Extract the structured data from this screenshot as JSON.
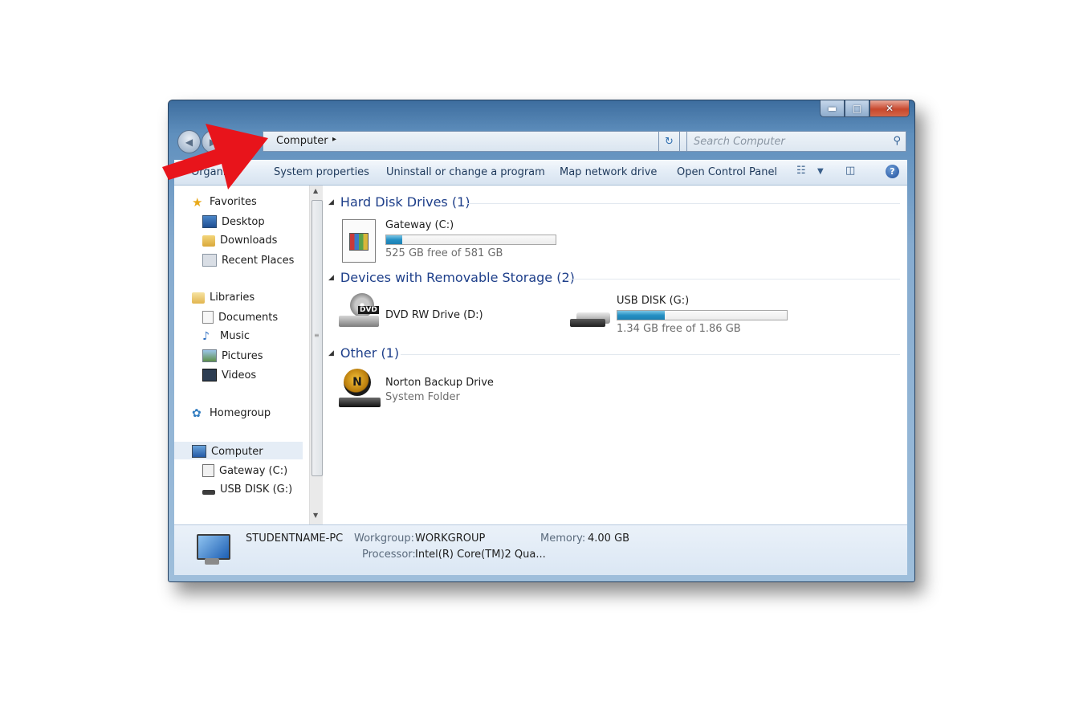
{
  "address_bar": {
    "crumb": "Computer",
    "separator": "▸",
    "dropdown": "▾",
    "refresh": "↻"
  },
  "search": {
    "placeholder": "Search Computer"
  },
  "title_buttons": {
    "minimize": "▬",
    "maximize": "□",
    "close": "✕"
  },
  "toolbar": {
    "organize": "Organize",
    "system_properties": "System properties",
    "uninstall": "Uninstall or change a program",
    "map_drive": "Map network drive",
    "control_panel": "Open Control Panel",
    "help": "?"
  },
  "sidebar": {
    "favorites": {
      "label": "Favorites",
      "items": [
        "Desktop",
        "Downloads",
        "Recent Places"
      ]
    },
    "libraries": {
      "label": "Libraries",
      "items": [
        "Documents",
        "Music",
        "Pictures",
        "Videos"
      ]
    },
    "homegroup": "Homegroup",
    "computer": {
      "label": "Computer",
      "items": [
        "Gateway (C:)",
        "USB DISK (G:)"
      ]
    }
  },
  "groups": {
    "hard_disk": {
      "title": "Hard Disk Drives (1)",
      "drive": {
        "name": "Gateway (C:)",
        "free": "525 GB free of 581 GB",
        "used_fraction": 0.096
      }
    },
    "removable": {
      "title": "Devices with Removable Storage (2)",
      "dvd": {
        "name": "DVD RW Drive (D:)",
        "icon_text": "DVD"
      },
      "usb": {
        "name": "USB DISK (G:)",
        "free": "1.34 GB free of 1.86 GB",
        "used_fraction": 0.28
      }
    },
    "other": {
      "title": "Other (1)",
      "item": {
        "name": "Norton Backup Drive",
        "sub": "System Folder",
        "icon_text": "N"
      }
    }
  },
  "details": {
    "pc_name": "STUDENTNAME-PC",
    "workgroup_label": "Workgroup:",
    "workgroup_value": "WORKGROUP",
    "memory_label": "Memory:",
    "memory_value": "4.00 GB",
    "processor_label": "Processor:",
    "processor_value": "Intel(R) Core(TM)2 Qua..."
  },
  "colors": {
    "annotation_arrow": "#e8141b",
    "link_blue": "#1e3f8a",
    "bar_fill": "#2590c4"
  }
}
